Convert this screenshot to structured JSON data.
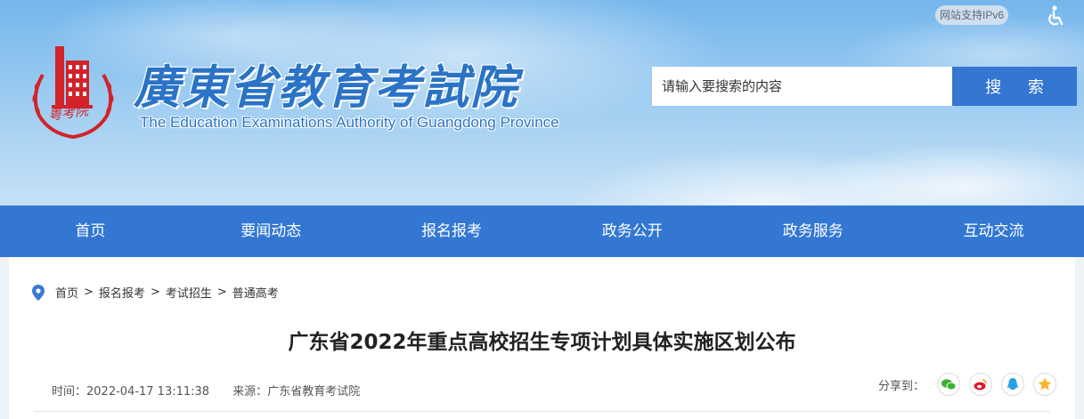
{
  "header": {
    "ipv6_label": "网站支持IPv6",
    "title_cn": "廣東省教育考試院",
    "title_en": "The Education Examinations Authority of Guangdong Province",
    "logo_text": "粤考院",
    "search": {
      "placeholder": "请输入要搜索的内容",
      "button_label": "搜 索"
    }
  },
  "nav": {
    "items": [
      {
        "label": "首页"
      },
      {
        "label": "要闻动态"
      },
      {
        "label": "报名报考"
      },
      {
        "label": "政务公开"
      },
      {
        "label": "政务服务"
      },
      {
        "label": "互动交流"
      }
    ]
  },
  "breadcrumb": [
    "首页",
    "报名报考",
    "考试招生",
    "普通高考"
  ],
  "breadcrumb_separator": ">",
  "article": {
    "title": "广东省2022年重点高校招生专项计划具体实施区划公布",
    "time": "时间：2022-04-17 13:11:38",
    "source": "来源：广东省教育考试院"
  },
  "share": {
    "label": "分享到：",
    "targets": [
      "wechat-icon",
      "weibo-icon",
      "qq-icon",
      "qzone-icon"
    ]
  },
  "colors": {
    "brand_blue": "#3377d3",
    "logo_red": "#d2232a"
  }
}
